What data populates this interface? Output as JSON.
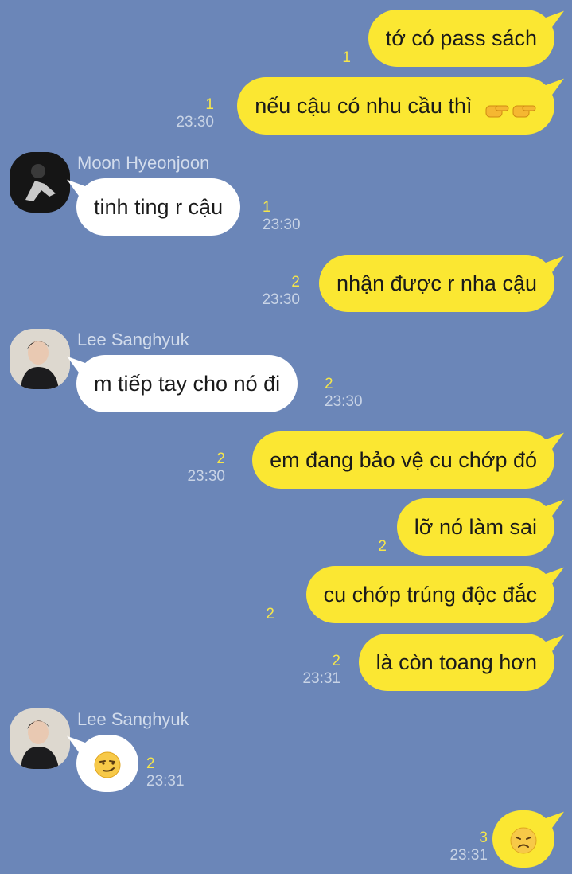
{
  "colors": {
    "background": "#6b86b8",
    "outgoing_bubble": "#fbe732",
    "incoming_bubble": "#ffffff",
    "unread": "#f6e64a",
    "time": "#c9d4e6",
    "sender": "#d2dcec"
  },
  "messages": [
    {
      "dir": "out",
      "text": "tớ có pass sách",
      "unread": "1",
      "time": ""
    },
    {
      "dir": "out",
      "text": "nếu cậu có nhu cầu thì",
      "emoji": "pointing-hand-icon x2",
      "unread": "1",
      "time": "23:30"
    },
    {
      "dir": "in",
      "sender": "Moon Hyeonjoon",
      "text": "tinh ting r cậu",
      "unread": "1",
      "time": "23:30"
    },
    {
      "dir": "out",
      "text": "nhận được r nha cậu",
      "unread": "2",
      "time": "23:30"
    },
    {
      "dir": "in",
      "sender": "Lee Sanghyuk",
      "text": "m tiếp tay cho nó đi",
      "unread": "2",
      "time": "23:30"
    },
    {
      "dir": "out",
      "text": "em đang bảo vệ cu chớp đó",
      "unread": "2",
      "time": "23:30"
    },
    {
      "dir": "out",
      "text": "lỡ nó làm sai",
      "unread": "2",
      "time": ""
    },
    {
      "dir": "out",
      "text": "cu chớp trúng độc đắc",
      "unread": "2",
      "time": ""
    },
    {
      "dir": "out",
      "text": "là còn toang hơn",
      "unread": "2",
      "time": "23:31"
    },
    {
      "dir": "in",
      "sender": "Lee Sanghyuk",
      "emoji": "smirk-emoji-icon",
      "unread": "2",
      "time": "23:31"
    },
    {
      "dir": "out",
      "emoji": "disappointed-emoji-icon",
      "unread": "3",
      "time": "23:31"
    }
  ]
}
